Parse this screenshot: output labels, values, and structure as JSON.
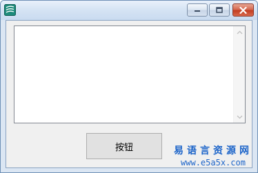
{
  "window": {
    "icon": "app-icon",
    "controls": {
      "minimize_icon": "minimize-icon",
      "maximize_icon": "maximize-icon",
      "close_icon": "close-icon"
    }
  },
  "textarea": {
    "value": ""
  },
  "button": {
    "label": "按钮"
  },
  "watermark": {
    "title": "易语言资源网",
    "url": "www.e5a5x.com"
  }
}
